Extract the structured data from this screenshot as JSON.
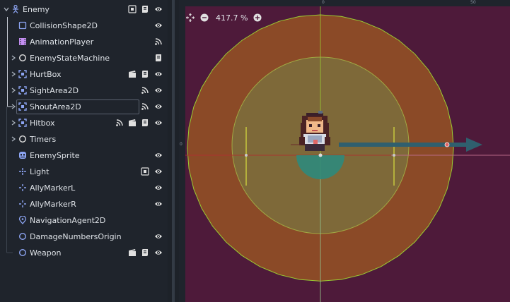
{
  "scene_tree": {
    "root": {
      "name": "Enemy",
      "icon": "character-body-icon"
    },
    "nodes": [
      {
        "name": "CollisionShape2D",
        "icon": "collision-shape-icon",
        "expandable": false
      },
      {
        "name": "AnimationPlayer",
        "icon": "animation-player-icon",
        "expandable": false
      },
      {
        "name": "EnemyStateMachine",
        "icon": "node-circle-icon",
        "expandable": true
      },
      {
        "name": "HurtBox",
        "icon": "area2d-icon",
        "expandable": true
      },
      {
        "name": "SightArea2D",
        "icon": "area2d-icon",
        "expandable": true
      },
      {
        "name": "ShoutArea2D",
        "icon": "area2d-icon",
        "expandable": true,
        "selected": true
      },
      {
        "name": "Hitbox",
        "icon": "area2d-icon",
        "expandable": true
      },
      {
        "name": "Timers",
        "icon": "node-circle-icon",
        "expandable": true
      },
      {
        "name": "EnemySprite",
        "icon": "sprite-icon",
        "expandable": false
      },
      {
        "name": "Light",
        "icon": "light-icon",
        "expandable": false
      },
      {
        "name": "AllyMarkerL",
        "icon": "marker-icon",
        "expandable": false
      },
      {
        "name": "AllyMarkerR",
        "icon": "marker-icon",
        "expandable": false
      },
      {
        "name": "NavigationAgent2D",
        "icon": "navigation-agent-icon",
        "expandable": false
      },
      {
        "name": "DamageNumbersOrigin",
        "icon": "node-circle-icon",
        "expandable": false
      },
      {
        "name": "Weapon",
        "icon": "node-circle-icon",
        "expandable": false
      }
    ]
  },
  "viewport": {
    "zoom_label": "417.7 %",
    "ruler_top": [
      "0",
      "50"
    ],
    "ruler_left": [
      "0"
    ],
    "colors": {
      "background": "#4e1a3a",
      "outer_area": "#8b4a27",
      "inner_area": "#7e6b3a",
      "outline": "#9acd32",
      "ray": "#2f5f6e"
    }
  }
}
